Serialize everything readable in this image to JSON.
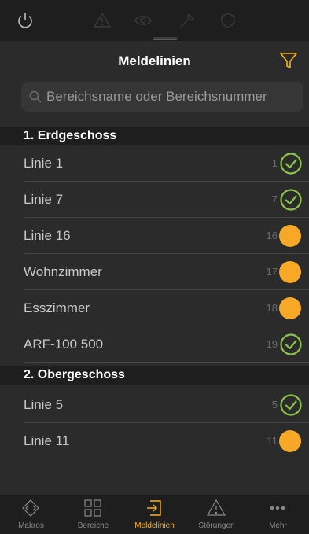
{
  "header": {
    "title": "Meldelinien"
  },
  "search": {
    "placeholder": "Bereichsname oder Bereichsnummer"
  },
  "sections": [
    {
      "title": "1. Erdgeschoss",
      "items": [
        {
          "label": "Linie 1",
          "number": "1",
          "status": "ok"
        },
        {
          "label": "Linie  7",
          "number": "7",
          "status": "ok"
        },
        {
          "label": "Linie 16",
          "number": "16",
          "status": "warning"
        },
        {
          "label": "Wohnzimmer",
          "number": "17",
          "status": "warning"
        },
        {
          "label": "Esszimmer",
          "number": "18",
          "status": "warning"
        },
        {
          "label": "ARF-100  500",
          "number": "19",
          "status": "ok"
        }
      ]
    },
    {
      "title": "2. Obergeschoss",
      "items": [
        {
          "label": "Linie  5",
          "number": "5",
          "status": "ok"
        },
        {
          "label": "Linie 11",
          "number": "11",
          "status": "warning"
        }
      ]
    }
  ],
  "tabbar": [
    {
      "label": "Makros",
      "icon": "diamond-arrows-icon",
      "active": false
    },
    {
      "label": "Bereiche",
      "icon": "grid-icon",
      "active": false
    },
    {
      "label": "Meldelinien",
      "icon": "login-icon",
      "active": true
    },
    {
      "label": "Störungen",
      "icon": "warning-icon",
      "active": false
    },
    {
      "label": "Mehr",
      "icon": "more-dots-icon",
      "active": false
    }
  ],
  "colors": {
    "accent": "#f4b41a",
    "ok": "#8bc34a",
    "warning": "#f7a827"
  }
}
